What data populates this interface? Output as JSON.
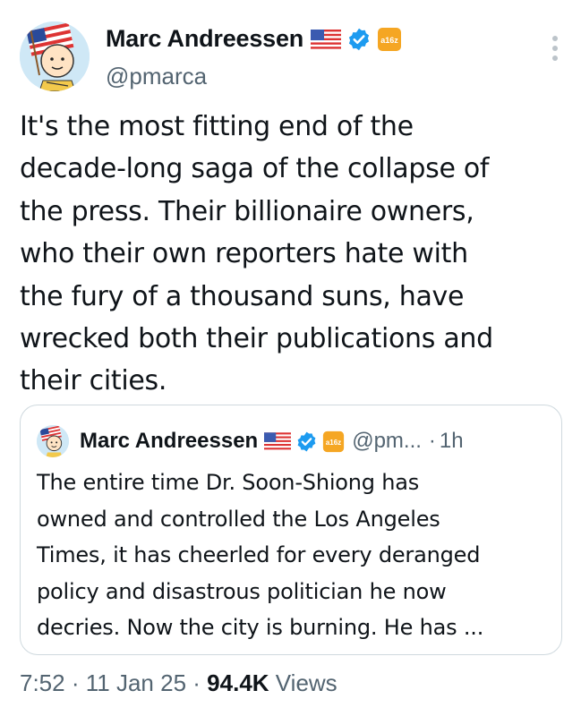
{
  "author": {
    "name": "Marc Andreessen",
    "handle": "@pmarca",
    "a16z_badge": "a16z",
    "icons": [
      "us-flag-icon",
      "verified-badge-icon",
      "a16z-affiliate-icon"
    ]
  },
  "tweet": {
    "lines": [
      "It's the most fitting end of the",
      "decade-long saga of the collapse of",
      "the press. Their billionaire owners,",
      "who their own reporters hate with",
      "the fury of a thousand suns, have",
      "wrecked both their publications and",
      "their cities."
    ]
  },
  "quote": {
    "name": "Marc Andreessen",
    "handle": "@pm...",
    "time_separator": "·",
    "time": "1h",
    "lines": [
      "The entire time Dr. Soon-Shiong has",
      "owned and controlled the Los Angeles",
      "Times, it has cheerled for every deranged",
      "policy and disastrous politician he now",
      "decries. Now the city is burning. He has ..."
    ]
  },
  "meta": {
    "time": "7:52",
    "sep1": "·",
    "date": "11 Jan 25",
    "sep2": "·",
    "views_count": "94.4K",
    "views_label": "Views"
  },
  "colors": {
    "text": "#0f1419",
    "secondary": "#536471",
    "verified": "#1d9bf0",
    "border": "#cfd9de",
    "a16z": "#f5a623"
  }
}
